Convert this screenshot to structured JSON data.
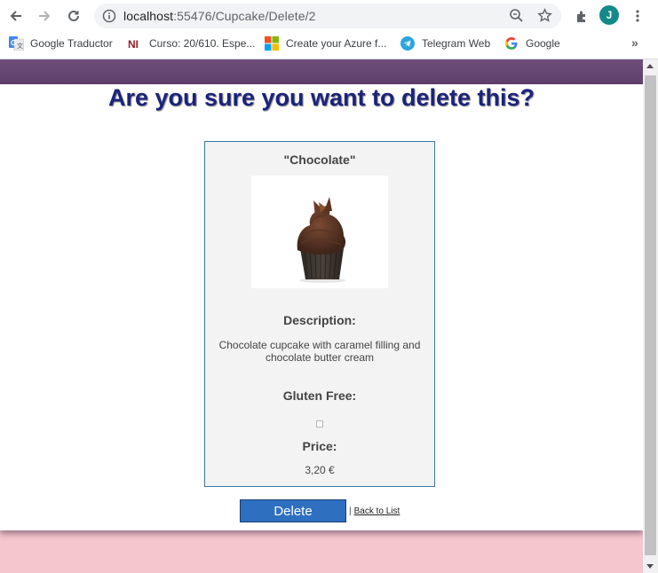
{
  "browser": {
    "url_host": "localhost",
    "url_path": ":55476/Cupcake/Delete/2",
    "profile_initial": "J",
    "profile_color": "#138a87"
  },
  "bookmarks": [
    {
      "label": "Google Traductor",
      "icon": "google-translate-icon"
    },
    {
      "label": "Curso: 20/610. Espe...",
      "icon": "ni-icon"
    },
    {
      "label": "Create your Azure f...",
      "icon": "microsoft-icon"
    },
    {
      "label": "Telegram Web",
      "icon": "telegram-icon"
    },
    {
      "label": "Google",
      "icon": "google-icon"
    }
  ],
  "page": {
    "title": "Are you sure you want to delete this?",
    "cupcake": {
      "name": "\"Chocolate\"",
      "description_label": "Description:",
      "description": "Chocolate cupcake with caramel filling and chocolate butter cream",
      "gluten_free_label": "Gluten Free:",
      "gluten_free": false,
      "price_label": "Price:",
      "price": "3,20 €"
    },
    "delete_label": "Delete",
    "separator": "|",
    "back_label": "Back to List"
  },
  "colors": {
    "title": "#1c237b",
    "band": "#6f4e7c",
    "background": "#f4c6cd",
    "button": "#2f6fc0",
    "card_border": "#3a7aa6"
  }
}
